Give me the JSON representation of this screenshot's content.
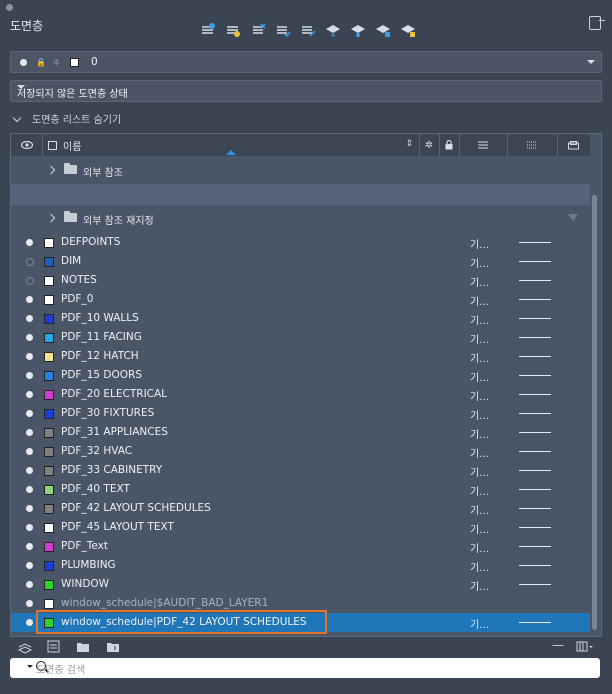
{
  "window": {
    "title": "도면층"
  },
  "current_layer": {
    "name": "0"
  },
  "layer_state": {
    "label": "저장되지 않은 도면층 상태"
  },
  "list_toggle": {
    "label": "도면층 리스트 숨기기"
  },
  "columns": {
    "name": "이름"
  },
  "groups": {
    "xref": "외부 참조",
    "xref_reload": "외부 참조 재지정"
  },
  "layers": [
    {
      "name": "DEFPOINTS",
      "color": "#ffffff",
      "on": true,
      "linetype": "기…"
    },
    {
      "name": "DIM",
      "color": "#1f5fb8",
      "on": false,
      "linetype": "기…"
    },
    {
      "name": "NOTES",
      "color": "#ffffff",
      "on": false,
      "linetype": "기…"
    },
    {
      "name": "PDF_0",
      "color": "#ffffff",
      "on": true,
      "linetype": "기…"
    },
    {
      "name": "PDF_10 WALLS",
      "color": "#1a3fd6",
      "on": true,
      "linetype": "기…"
    },
    {
      "name": "PDF_11 FACING",
      "color": "#29a8e8",
      "on": true,
      "linetype": "기…"
    },
    {
      "name": "PDF_12 HATCH",
      "color": "#f2e48c",
      "on": true,
      "linetype": "기…"
    },
    {
      "name": "PDF_15 DOORS",
      "color": "#2b7fe0",
      "on": true,
      "linetype": "기…"
    },
    {
      "name": "PDF_20 ELECTRICAL",
      "color": "#d43ad4",
      "on": true,
      "linetype": "기…"
    },
    {
      "name": "PDF_30 FIXTURES",
      "color": "#1a3fd6",
      "on": true,
      "linetype": "기…"
    },
    {
      "name": "PDF_31 APPLIANCES",
      "color": "#808080",
      "on": true,
      "linetype": "기…"
    },
    {
      "name": "PDF_32 HVAC",
      "color": "#808080",
      "on": true,
      "linetype": "기…"
    },
    {
      "name": "PDF_33 CABINETRY",
      "color": "#808080",
      "on": true,
      "linetype": "기…"
    },
    {
      "name": "PDF_40 TEXT",
      "color": "#8fd47a",
      "on": true,
      "linetype": "기…"
    },
    {
      "name": "PDF_42 LAYOUT SCHEDULES",
      "color": "#808080",
      "on": true,
      "linetype": "기…"
    },
    {
      "name": "PDF_45 LAYOUT TEXT",
      "color": "#ffffff",
      "on": true,
      "linetype": "기…"
    },
    {
      "name": "PDF_Text",
      "color": "#d43ad4",
      "on": true,
      "linetype": "기…"
    },
    {
      "name": "PLUMBING",
      "color": "#1a3fd6",
      "on": true,
      "linetype": "기…"
    },
    {
      "name": "WINDOW",
      "color": "#2ed12e",
      "on": true,
      "linetype": "기…"
    },
    {
      "name": "window_schedule|$AUDIT_BAD_LAYER1",
      "color": "#ffffff",
      "on": true,
      "linetype": "",
      "dim": true
    },
    {
      "name": "window_schedule|PDF_42 LAYOUT SCHEDULES",
      "color": "#2ed12e",
      "on": true,
      "linetype": "기…",
      "selected": true
    }
  ],
  "search": {
    "placeholder": "도면층 검색"
  },
  "colors": {
    "selection": "#1f76b8",
    "highlight_box": "#e0752b"
  }
}
